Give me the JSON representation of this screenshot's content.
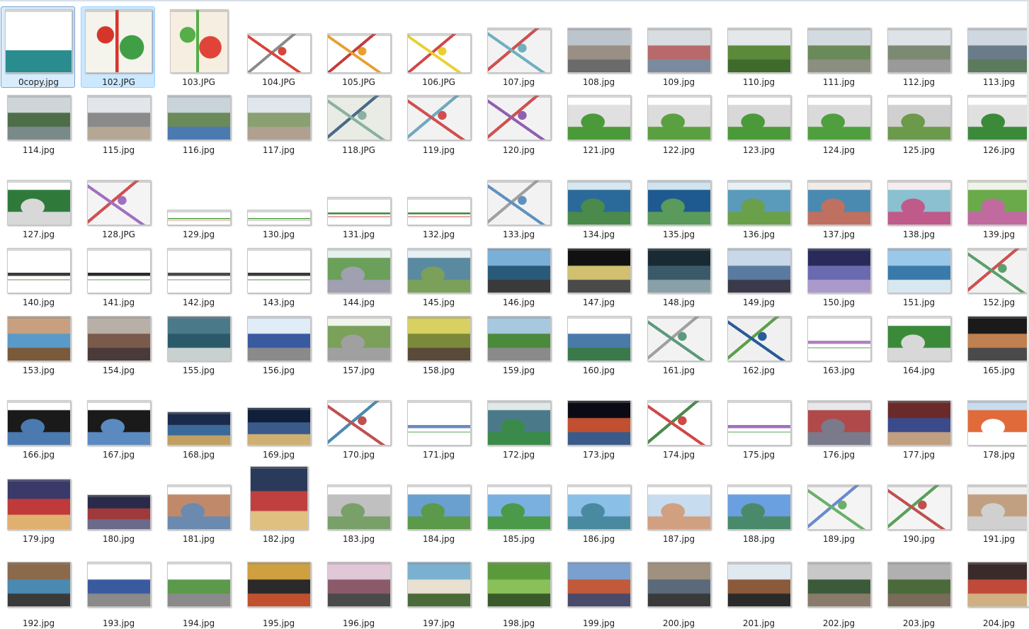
{
  "window": {
    "view": "large-icons"
  },
  "colors": {
    "selection": "#cce8ff",
    "selection_border": "#99d1ff",
    "label": "#1e1e1e",
    "background": "#ffffff"
  },
  "files": [
    {
      "name": "0copy.jpg",
      "kind": "doc",
      "colors": [
        "#ffffff",
        "#2a8c8f",
        "#e8f0f0"
      ],
      "state": "selected2"
    },
    {
      "name": "102.JPG",
      "kind": "map",
      "colors": [
        "#f4f4ec",
        "#3f9e46",
        "#d6352c"
      ],
      "state": "selected"
    },
    {
      "name": "103.JPG",
      "kind": "map",
      "colors": [
        "#f6eee0",
        "#e04438",
        "#55ae48"
      ]
    },
    {
      "name": "104.JPG",
      "kind": "plan",
      "colors": [
        "#ffffff",
        "#d8453a",
        "#8a8a8a"
      ]
    },
    {
      "name": "105.JPG",
      "kind": "plan",
      "colors": [
        "#ffffff",
        "#e8a030",
        "#c43c3c"
      ]
    },
    {
      "name": "106.JPG",
      "kind": "plan",
      "colors": [
        "#ffffff",
        "#e8d030",
        "#d04848"
      ]
    },
    {
      "name": "107.jpg",
      "kind": "plan",
      "colors": [
        "#f2f2f2",
        "#6fb0c0",
        "#d05050"
      ]
    },
    {
      "name": "108.jpg",
      "kind": "photo",
      "colors": [
        "#bcc4cc",
        "#9a8f84",
        "#6b6b6b"
      ]
    },
    {
      "name": "109.jpg",
      "kind": "photo",
      "colors": [
        "#d8dde2",
        "#b86a6a",
        "#7a8ba0"
      ]
    },
    {
      "name": "110.jpg",
      "kind": "photo",
      "colors": [
        "#e4e8ea",
        "#5a8a3a",
        "#3f6a2c"
      ]
    },
    {
      "name": "111.jpg",
      "kind": "photo",
      "colors": [
        "#d4dbe0",
        "#6a8a5a",
        "#8a8f80"
      ]
    },
    {
      "name": "112.jpg",
      "kind": "photo",
      "colors": [
        "#dde3e6",
        "#7c8a74",
        "#9a9a9a"
      ]
    },
    {
      "name": "113.jpg",
      "kind": "photo",
      "colors": [
        "#cfd8e0",
        "#6a7c8a",
        "#5c7a5c"
      ]
    },
    {
      "name": "114.jpg",
      "kind": "photo",
      "colors": [
        "#cfd6da",
        "#4e6e4a",
        "#7a8a88"
      ]
    },
    {
      "name": "115.jpg",
      "kind": "photo",
      "colors": [
        "#e2e6ea",
        "#8a8a8a",
        "#b4a894"
      ]
    },
    {
      "name": "116.jpg",
      "kind": "photo",
      "colors": [
        "#c9d3da",
        "#6a8a5a",
        "#4a7ab0"
      ]
    },
    {
      "name": "117.jpg",
      "kind": "photo",
      "colors": [
        "#e0e6ee",
        "#8aa070",
        "#b0a090"
      ]
    },
    {
      "name": "118.JPG",
      "kind": "plan",
      "colors": [
        "#e8ece4",
        "#8ab0a0",
        "#4a6a8a"
      ]
    },
    {
      "name": "119.jpg",
      "kind": "plan",
      "colors": [
        "#f2f2f2",
        "#d05050",
        "#70a8c0"
      ]
    },
    {
      "name": "120.jpg",
      "kind": "plan",
      "colors": [
        "#f2f2f2",
        "#9060b0",
        "#d05050"
      ]
    },
    {
      "name": "121.jpg",
      "kind": "render",
      "colors": [
        "#ffffff",
        "#e0e0e0",
        "#4a9a3a"
      ]
    },
    {
      "name": "122.jpg",
      "kind": "render",
      "colors": [
        "#ffffff",
        "#dcdcdc",
        "#5aa040"
      ]
    },
    {
      "name": "123.jpg",
      "kind": "render",
      "colors": [
        "#ffffff",
        "#d8d8d8",
        "#4a9a3a"
      ]
    },
    {
      "name": "124.jpg",
      "kind": "render",
      "colors": [
        "#ffffff",
        "#dadada",
        "#4f9f3f"
      ]
    },
    {
      "name": "125.jpg",
      "kind": "render",
      "colors": [
        "#ffffff",
        "#d0d0d0",
        "#6a9a4a"
      ]
    },
    {
      "name": "126.jpg",
      "kind": "render",
      "colors": [
        "#ffffff",
        "#e0e0e0",
        "#3a8a3a"
      ]
    },
    {
      "name": "127.jpg",
      "kind": "render",
      "colors": [
        "#ffffff",
        "#2f7a3a",
        "#d8d8d8"
      ]
    },
    {
      "name": "128.JPG",
      "kind": "plan",
      "colors": [
        "#f4f4f4",
        "#a070c0",
        "#d05050"
      ]
    },
    {
      "name": "129.jpg",
      "kind": "section",
      "colors": [
        "#ffffff",
        "#4a9a3a",
        "#c07050"
      ]
    },
    {
      "name": "130.jpg",
      "kind": "section",
      "colors": [
        "#ffffff",
        "#4a9a3a",
        "#8a8a8a"
      ]
    },
    {
      "name": "131.jpg",
      "kind": "section",
      "colors": [
        "#ffffff",
        "#3a8a3a",
        "#d04848"
      ]
    },
    {
      "name": "132.jpg",
      "kind": "section",
      "colors": [
        "#ffffff",
        "#3a8a3a",
        "#d04848"
      ]
    },
    {
      "name": "133.jpg",
      "kind": "plan",
      "colors": [
        "#f2f2f2",
        "#6090c0",
        "#a0a0a0"
      ]
    },
    {
      "name": "134.jpg",
      "kind": "render",
      "colors": [
        "#d8e8f0",
        "#2a6a9a",
        "#4a8a4a"
      ]
    },
    {
      "name": "135.jpg",
      "kind": "render",
      "colors": [
        "#d0e4f0",
        "#1e5a90",
        "#5a9a5a"
      ]
    },
    {
      "name": "136.jpg",
      "kind": "render",
      "colors": [
        "#e8f0f4",
        "#5a9aba",
        "#6aa04a"
      ]
    },
    {
      "name": "137.jpg",
      "kind": "render",
      "colors": [
        "#f0ecea",
        "#4a8ab0",
        "#c07060"
      ]
    },
    {
      "name": "138.jpg",
      "kind": "render",
      "colors": [
        "#f4eef0",
        "#8ac0d0",
        "#c05a8a"
      ]
    },
    {
      "name": "139.jpg",
      "kind": "render",
      "colors": [
        "#eef4e8",
        "#6aaa4a",
        "#c06aa0"
      ]
    },
    {
      "name": "140.jpg",
      "kind": "section",
      "colors": [
        "#ffffff",
        "#3a3a3a",
        "#6a8a5a"
      ]
    },
    {
      "name": "141.jpg",
      "kind": "section",
      "colors": [
        "#ffffff",
        "#2a2a2a",
        "#6a9a5a"
      ]
    },
    {
      "name": "142.jpg",
      "kind": "section",
      "colors": [
        "#ffffff",
        "#4a4a4a",
        "#8a8a8a"
      ]
    },
    {
      "name": "143.jpg",
      "kind": "section",
      "colors": [
        "#ffffff",
        "#3a3a3a",
        "#5a8a4a"
      ]
    },
    {
      "name": "144.jpg",
      "kind": "render",
      "colors": [
        "#e8f0f0",
        "#6aa05a",
        "#a0a0b0"
      ]
    },
    {
      "name": "145.jpg",
      "kind": "render",
      "colors": [
        "#e8f0f4",
        "#5a8aa0",
        "#7aa05a"
      ]
    },
    {
      "name": "146.jpg",
      "kind": "photo",
      "colors": [
        "#7ab0d8",
        "#2a5a7a",
        "#3a3a3a"
      ]
    },
    {
      "name": "147.jpg",
      "kind": "photo",
      "colors": [
        "#111111",
        "#d0c070",
        "#4a4a4a"
      ]
    },
    {
      "name": "148.jpg",
      "kind": "photo",
      "colors": [
        "#1a2a34",
        "#3a5a6a",
        "#8aa0a8"
      ]
    },
    {
      "name": "149.jpg",
      "kind": "photo",
      "colors": [
        "#c8d8e8",
        "#5a7aa0",
        "#3a3a4a"
      ]
    },
    {
      "name": "150.jpg",
      "kind": "photo",
      "colors": [
        "#2a2a5a",
        "#6a6ab0",
        "#aa9acc"
      ]
    },
    {
      "name": "151.jpg",
      "kind": "photo",
      "colors": [
        "#9ac8e8",
        "#3a7aaa",
        "#d8e8f0"
      ]
    },
    {
      "name": "152.jpg",
      "kind": "plan",
      "colors": [
        "#f2f2f2",
        "#5aa06a",
        "#d05050"
      ]
    },
    {
      "name": "153.jpg",
      "kind": "photo",
      "colors": [
        "#c8a080",
        "#5a9ac8",
        "#7a5a3a"
      ]
    },
    {
      "name": "154.jpg",
      "kind": "photo",
      "colors": [
        "#b8b0a8",
        "#7a5a4a",
        "#4a3a3a"
      ]
    },
    {
      "name": "155.jpg",
      "kind": "photo",
      "colors": [
        "#4a7a8a",
        "#2a5a6a",
        "#c8d0d0"
      ]
    },
    {
      "name": "156.jpg",
      "kind": "photo",
      "colors": [
        "#e0ecf8",
        "#3a5aa0",
        "#8a8a8a"
      ]
    },
    {
      "name": "157.jpg",
      "kind": "render",
      "colors": [
        "#f0f4ec",
        "#7aa05a",
        "#a0a0a0"
      ]
    },
    {
      "name": "158.jpg",
      "kind": "photo",
      "colors": [
        "#d8d060",
        "#7a8a3a",
        "#5a4a3a"
      ]
    },
    {
      "name": "159.jpg",
      "kind": "photo",
      "colors": [
        "#a8c8e0",
        "#4a8a3a",
        "#8a8a8a"
      ]
    },
    {
      "name": "160.jpg",
      "kind": "photo",
      "colors": [
        "#ffffff",
        "#4a7aa8",
        "#3a7a4a"
      ]
    },
    {
      "name": "161.jpg",
      "kind": "plan",
      "colors": [
        "#f2f2f2",
        "#5a9a7a",
        "#a0a0a0"
      ]
    },
    {
      "name": "162.jpg",
      "kind": "plan",
      "colors": [
        "#f0f0f0",
        "#2a5a9a",
        "#5aa04a"
      ]
    },
    {
      "name": "163.jpg",
      "kind": "section",
      "colors": [
        "#ffffff",
        "#b080c0",
        "#5aa05a"
      ]
    },
    {
      "name": "164.jpg",
      "kind": "render",
      "colors": [
        "#ffffff",
        "#3a8a3a",
        "#d8d8d8"
      ]
    },
    {
      "name": "165.jpg",
      "kind": "photo",
      "colors": [
        "#1a1a1a",
        "#c08050",
        "#4a4a4a"
      ]
    },
    {
      "name": "166.jpg",
      "kind": "render",
      "colors": [
        "#ffffff",
        "#1a1a1a",
        "#4a7ab0"
      ]
    },
    {
      "name": "167.jpg",
      "kind": "render",
      "colors": [
        "#ffffff",
        "#1a1a1a",
        "#5a8ac0"
      ]
    },
    {
      "name": "168.jpg",
      "kind": "photo",
      "colors": [
        "#1a2a4a",
        "#3a6a9a",
        "#c0a060"
      ]
    },
    {
      "name": "169.jpg",
      "kind": "photo",
      "colors": [
        "#10203a",
        "#3a5a8a",
        "#d0b070"
      ]
    },
    {
      "name": "170.jpg",
      "kind": "plan",
      "colors": [
        "#ffffff",
        "#c05050",
        "#4a8ab0"
      ]
    },
    {
      "name": "171.jpg",
      "kind": "section",
      "colors": [
        "#ffffff",
        "#6a8ac0",
        "#5aa05a"
      ]
    },
    {
      "name": "172.jpg",
      "kind": "render",
      "colors": [
        "#e0e8e8",
        "#4a7a8a",
        "#3a8a4a"
      ]
    },
    {
      "name": "173.jpg",
      "kind": "photo",
      "colors": [
        "#0a0a14",
        "#c05030",
        "#3a5a8a"
      ]
    },
    {
      "name": "174.jpg",
      "kind": "plan",
      "colors": [
        "#ffffff",
        "#d04848",
        "#4a8a4a"
      ]
    },
    {
      "name": "175.jpg",
      "kind": "section",
      "colors": [
        "#ffffff",
        "#a070c0",
        "#5aa05a"
      ]
    },
    {
      "name": "176.jpg",
      "kind": "render",
      "colors": [
        "#e8e8ec",
        "#b04a4a",
        "#7a7a8a"
      ]
    },
    {
      "name": "177.jpg",
      "kind": "photo",
      "colors": [
        "#6a2a2a",
        "#3a4a8a",
        "#c0a080"
      ]
    },
    {
      "name": "178.jpg",
      "kind": "render",
      "colors": [
        "#c8dcf0",
        "#e06a3a",
        "#ffffff"
      ]
    },
    {
      "name": "179.jpg",
      "kind": "photo",
      "colors": [
        "#3a3a6a",
        "#c03a3a",
        "#e0b070"
      ]
    },
    {
      "name": "180.jpg",
      "kind": "photo",
      "colors": [
        "#2a2a4a",
        "#a03a3a",
        "#6a6a8a"
      ]
    },
    {
      "name": "181.jpg",
      "kind": "render",
      "colors": [
        "#ffffff",
        "#c08a6a",
        "#6a8ab0"
      ]
    },
    {
      "name": "182.jpg",
      "kind": "photo",
      "colors": [
        "#2a3a5a",
        "#c04040",
        "#e0c080"
      ]
    },
    {
      "name": "183.jpg",
      "kind": "render",
      "colors": [
        "#ffffff",
        "#c0c0c0",
        "#7aa06a"
      ]
    },
    {
      "name": "184.jpg",
      "kind": "render",
      "colors": [
        "#ffffff",
        "#6aa0d0",
        "#5a9a4a"
      ]
    },
    {
      "name": "185.jpg",
      "kind": "render",
      "colors": [
        "#ffffff",
        "#7ab0e0",
        "#4a9a4a"
      ]
    },
    {
      "name": "186.jpg",
      "kind": "render",
      "colors": [
        "#ffffff",
        "#8ac0e8",
        "#4a8aa0"
      ]
    },
    {
      "name": "187.jpg",
      "kind": "render",
      "colors": [
        "#ffffff",
        "#c8dcf0",
        "#d0a080"
      ]
    },
    {
      "name": "188.jpg",
      "kind": "render",
      "colors": [
        "#ffffff",
        "#6aa0e0",
        "#4a8a6a"
      ]
    },
    {
      "name": "189.jpg",
      "kind": "plan",
      "colors": [
        "#f4f4f4",
        "#6ab06a",
        "#6a8ad0"
      ]
    },
    {
      "name": "190.jpg",
      "kind": "plan",
      "colors": [
        "#f4f4f4",
        "#c05050",
        "#5aa05a"
      ]
    },
    {
      "name": "191.jpg",
      "kind": "render",
      "colors": [
        "#f0f0f0",
        "#c0a080",
        "#d0d0d0"
      ]
    },
    {
      "name": "192.jpg",
      "kind": "photo",
      "colors": [
        "#8a6a4a",
        "#4a8ab0",
        "#3a3a3a"
      ]
    },
    {
      "name": "193.jpg",
      "kind": "photo",
      "colors": [
        "#ffffff",
        "#3a5aa0",
        "#8a8a8a"
      ]
    },
    {
      "name": "194.jpg",
      "kind": "photo",
      "colors": [
        "#ffffff",
        "#5a9a4a",
        "#8a8a8a"
      ]
    },
    {
      "name": "195.jpg",
      "kind": "photo",
      "colors": [
        "#d0a040",
        "#2a2a2a",
        "#c05030"
      ]
    },
    {
      "name": "196.jpg",
      "kind": "photo",
      "colors": [
        "#e0c8d8",
        "#8a5a6a",
        "#4a4a4a"
      ]
    },
    {
      "name": "197.jpg",
      "kind": "photo",
      "colors": [
        "#7ab0d0",
        "#e8e0d0",
        "#4a6a3a"
      ]
    },
    {
      "name": "198.jpg",
      "kind": "photo",
      "colors": [
        "#5a9a3a",
        "#8ac05a",
        "#3a5a2a"
      ]
    },
    {
      "name": "199.jpg",
      "kind": "photo",
      "colors": [
        "#7aa0d0",
        "#c05a3a",
        "#4a4a6a"
      ]
    },
    {
      "name": "200.jpg",
      "kind": "photo",
      "colors": [
        "#a09080",
        "#5a6a7a",
        "#3a3a3a"
      ]
    },
    {
      "name": "201.jpg",
      "kind": "photo",
      "colors": [
        "#e0e8f0",
        "#8a5a3a",
        "#2a2a2a"
      ]
    },
    {
      "name": "202.jpg",
      "kind": "photo",
      "colors": [
        "#c8c8c8",
        "#3a5a3a",
        "#8a7a6a"
      ]
    },
    {
      "name": "203.jpg",
      "kind": "photo",
      "colors": [
        "#b0b0b0",
        "#4a6a3a",
        "#7a6a5a"
      ]
    },
    {
      "name": "204.jpg",
      "kind": "photo",
      "colors": [
        "#3a2a2a",
        "#c04a3a",
        "#d0b080"
      ]
    }
  ]
}
